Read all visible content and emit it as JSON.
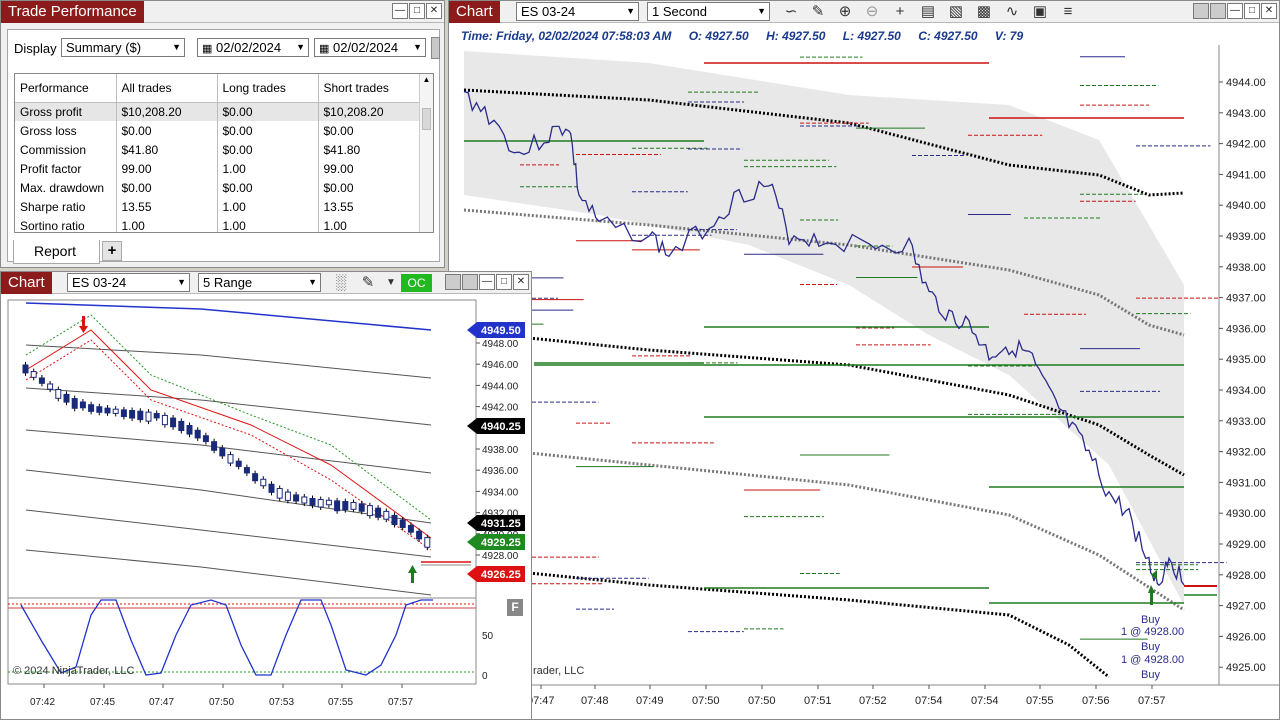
{
  "trade_performance": {
    "title": "Trade Performance",
    "display_label": "Display",
    "display_value": "Summary ($)",
    "date_from": "02/02/2024",
    "date_to": "02/02/2024",
    "columns": [
      "Performance",
      "All trades",
      "Long trades",
      "Short trades"
    ],
    "rows": [
      [
        "Gross profit",
        "$10,208.20",
        "$0.00",
        "$10,208.20"
      ],
      [
        "Gross loss",
        "$0.00",
        "$0.00",
        "$0.00"
      ],
      [
        "Commission",
        "$41.80",
        "$0.00",
        "$41.80"
      ],
      [
        "Profit factor",
        "99.00",
        "1.00",
        "99.00"
      ],
      [
        "Max. drawdown",
        "$0.00",
        "$0.00",
        "$0.00"
      ],
      [
        "Sharpe ratio",
        "13.55",
        "1.00",
        "13.55"
      ],
      [
        "Sortino ratio",
        "1.00",
        "1.00",
        "1.00"
      ]
    ],
    "tab": "Report",
    "add_tab": "+"
  },
  "chart_left": {
    "title": "Chart",
    "instrument": "ES 03-24",
    "interval": "5 Range",
    "oc_label": "OC",
    "copyright": "© 2024 NinjaTrader, LLC",
    "indicator_button": "F",
    "price_labels": [
      "4949.50",
      "4940.25",
      "4931.25",
      "4929.25",
      "4926.25"
    ],
    "price_axis": [
      "4948.00",
      "4946.00",
      "4944.00",
      "4942.00",
      "4940.00",
      "4938.00",
      "4936.00",
      "4934.00",
      "4932.00",
      "4930.00",
      "4928.00"
    ],
    "osc_axis": [
      "50",
      "0"
    ],
    "time_axis": [
      "07:42",
      "07:45",
      "07:47",
      "07:50",
      "07:53",
      "07:55",
      "07:57"
    ]
  },
  "chart_right": {
    "title": "Chart",
    "instrument": "ES 03-24",
    "interval": "1 Second",
    "info": {
      "time": "Time: Friday, 02/02/2024 07:58:03 AM",
      "open": "O: 4927.50",
      "high": "H: 4927.50",
      "low": "L: 4927.50",
      "close": "C: 4927.50",
      "volume": "V: 79"
    },
    "copyright_fragment": "rader, LLC",
    "price_axis": [
      "4944.00",
      "4943.00",
      "4942.00",
      "4941.00",
      "4940.00",
      "4939.00",
      "4938.00",
      "4937.00",
      "4936.00",
      "4935.00",
      "4934.00",
      "4933.00",
      "4932.00",
      "4931.00",
      "4930.00",
      "4929.00",
      "4928.00",
      "4927.00",
      "4926.00",
      "4925.00"
    ],
    "time_axis": [
      "07:47",
      "07:48",
      "07:49",
      "07:50",
      "07:50",
      "07:51",
      "07:52",
      "07:54",
      "07:54",
      "07:55",
      "07:56",
      "07:57"
    ],
    "trade_labels": [
      "Buy",
      "1 @ 4928.00",
      "Buy",
      "1 @ 4928.00",
      "Buy"
    ]
  },
  "colors": {
    "title_red": "#8c1c1c",
    "price_line": "#2b2b8c",
    "buy_green": "#1f7a1f",
    "sell_red": "#cc1111",
    "band_gray": "#e6e6e6"
  }
}
